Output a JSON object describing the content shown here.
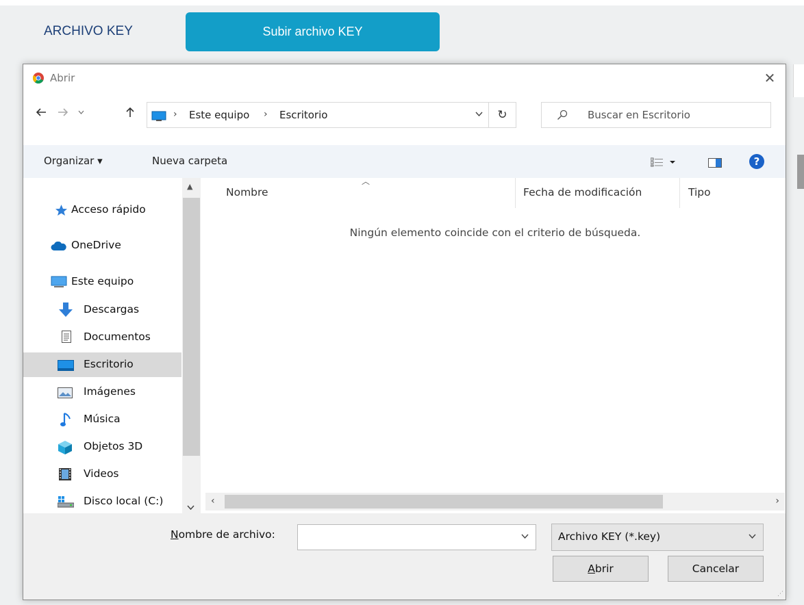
{
  "background": {
    "section_label": "ARCHIVO KEY",
    "upload_button": "Subir archivo KEY",
    "accent_color": "#139ec8"
  },
  "dialog": {
    "title": "Abrir",
    "title_icon": "chrome-icon",
    "close_glyph": "✕",
    "address": {
      "icon": "computer-icon",
      "crumbs": [
        "Este equipo",
        "Escritorio"
      ]
    },
    "search_placeholder": "Buscar en Escritorio",
    "toolbar": {
      "organize": "Organizar ▾",
      "new_folder": "Nueva carpeta",
      "help": "?"
    },
    "nav_items": [
      {
        "label": "Acceso rápido",
        "icon": "star-icon"
      },
      {
        "label": "OneDrive",
        "icon": "cloud-icon"
      },
      {
        "label": "Este equipo",
        "icon": "computer-icon"
      },
      {
        "label": "Descargas",
        "icon": "download-icon"
      },
      {
        "label": "Documentos",
        "icon": "document-icon"
      },
      {
        "label": "Escritorio",
        "icon": "desktop-icon",
        "selected": true
      },
      {
        "label": "Imágenes",
        "icon": "image-icon"
      },
      {
        "label": "Música",
        "icon": "music-icon"
      },
      {
        "label": "Objetos 3D",
        "icon": "cube-icon"
      },
      {
        "label": "Videos",
        "icon": "video-icon"
      },
      {
        "label": "Disco local (C:)",
        "icon": "drive-icon"
      }
    ],
    "columns": [
      "Nombre",
      "Fecha de modificación",
      "Tipo"
    ],
    "empty_message": "Ningún elemento coincide con el criterio de búsqueda.",
    "filename_label_first": "N",
    "filename_label_rest": "ombre de archivo:",
    "filename_value": "",
    "file_type": "Archivo KEY (*.key)",
    "open_first": "A",
    "open_rest": "brir",
    "cancel": "Cancelar"
  }
}
